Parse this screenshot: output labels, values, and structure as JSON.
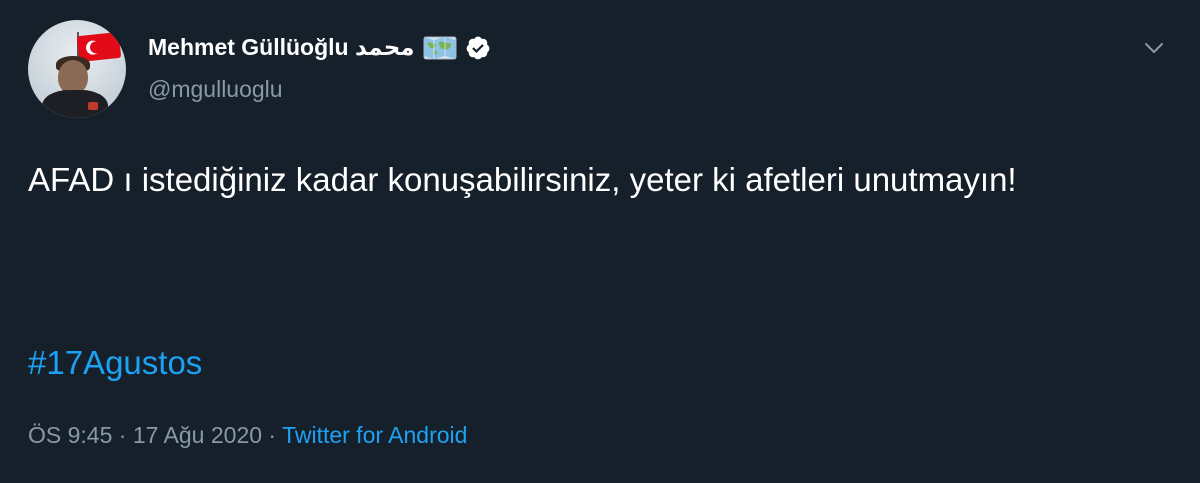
{
  "user": {
    "display_name": "Mehmet Güllüoğlu محمد",
    "handle": "@mgulluoglu",
    "verified": true,
    "emoji_icon": "world-map-icon"
  },
  "tweet": {
    "text": "AFAD ı istediğiniz kadar konuşabilirsiniz, yeter ki afetleri unutmayın!",
    "hashtag": "#17Agustos"
  },
  "meta": {
    "time": "ÖS 9:45",
    "separator_1": " · ",
    "date": "17 Ağu 2020",
    "separator_2": " · ",
    "source": "Twitter for Android"
  },
  "colors": {
    "background": "#15202b",
    "link": "#1da1f2",
    "secondary_text": "#8899a6",
    "primary_text": "#ffffff"
  }
}
